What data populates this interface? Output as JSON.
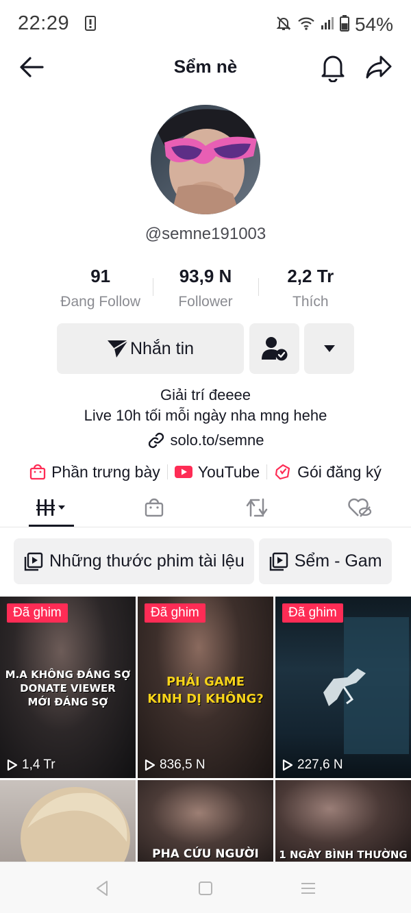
{
  "status_bar": {
    "time": "22:29",
    "battery": "54%"
  },
  "header": {
    "title": "Sểm nè"
  },
  "profile": {
    "username": "@semne191003"
  },
  "stats": [
    {
      "value": "91",
      "label": "Đang Follow"
    },
    {
      "value": "93,9 N",
      "label": "Follower"
    },
    {
      "value": "2,2 Tr",
      "label": "Thích"
    }
  ],
  "actions": {
    "message_label": "Nhắn tin"
  },
  "bio": {
    "line1": "Giải trí đeeee",
    "line2": "Live 10h tối mỗi ngày nha mng hehe",
    "link": "solo.to/semne"
  },
  "shortcuts": [
    {
      "label": "Phần trưng bày",
      "icon": "shop-bag-icon"
    },
    {
      "label": "YouTube",
      "icon": "youtube-icon"
    },
    {
      "label": "Gói đăng ký",
      "icon": "subscription-icon"
    }
  ],
  "playlists": [
    {
      "label": "Những thước phim tài lệu"
    },
    {
      "label": "Sểm - Gam"
    }
  ],
  "videos": [
    {
      "pinned": "Đã ghim",
      "views": "1,4 Tr",
      "caption": [
        "M.A KHÔNG ĐÁNG SỢ",
        "DONATE VIEWER",
        "MỚI ĐÁNG SỢ"
      ]
    },
    {
      "pinned": "Đã ghim",
      "views": "836,5 N",
      "caption": [
        "PHẢI GAME",
        "KINH DỊ KHÔNG?"
      ]
    },
    {
      "pinned": "Đã ghim",
      "views": "227,6 N",
      "caption": []
    },
    {
      "pinned": "",
      "views": "",
      "caption": []
    },
    {
      "pinned": "",
      "views": "",
      "caption": [
        "PHA CỨU NGƯỜI"
      ]
    },
    {
      "pinned": "",
      "views": "",
      "caption": [
        "1 NGÀY BÌNH THƯỜNG"
      ]
    }
  ],
  "colors": {
    "accent": "#fe2c55",
    "text": "#161823",
    "muted": "#8a8b91",
    "button_bg": "#efefef"
  }
}
